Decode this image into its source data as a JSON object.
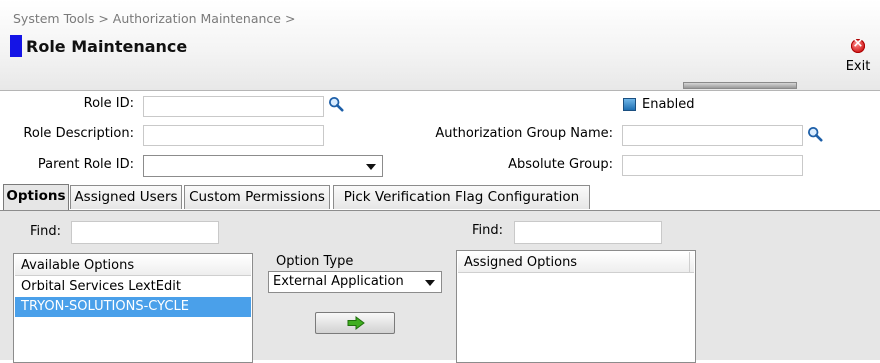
{
  "breadcrumb": "System Tools > Authorization Maintenance >",
  "page_title": "Role Maintenance",
  "toolbar": {
    "exit_label": "Exit"
  },
  "form": {
    "role_id_label": "Role ID:",
    "role_id_value": "",
    "role_description_label": "Role Description:",
    "role_description_value": "",
    "parent_role_id_label": "Parent Role ID:",
    "parent_role_id_value": "",
    "enabled_label": "Enabled",
    "enabled_checked": true,
    "auth_group_name_label": "Authorization Group Name:",
    "auth_group_name_value": "",
    "absolute_group_label": "Absolute Group:",
    "absolute_group_value": ""
  },
  "tabs": [
    {
      "label": "Options",
      "active": true
    },
    {
      "label": "Assigned Users",
      "active": false
    },
    {
      "label": "Custom Permissions",
      "active": false
    },
    {
      "label": "Pick Verification Flag Configuration",
      "active": false
    }
  ],
  "options_tab": {
    "find_label_left": "Find:",
    "find_value_left": "",
    "find_label_right": "Find:",
    "find_value_right": "",
    "available_header": "Available Options",
    "available_items": [
      {
        "label": "Orbital Services LextEdit",
        "selected": false
      },
      {
        "label": "TRYON-SOLUTIONS-CYCLE",
        "selected": true
      }
    ],
    "option_type_label": "Option Type",
    "option_type_value": "External Application",
    "assigned_header": "Assigned Options",
    "assigned_items": []
  },
  "icons": {
    "search": "magnifier-icon",
    "exit": "close-circle-icon",
    "move": "right-arrow-icon"
  },
  "colors": {
    "title_marker": "#1414e6",
    "selected_row": "#4aa0ea",
    "exit_icon": "#d11a1a",
    "move_arrow": "#3fae1f"
  }
}
